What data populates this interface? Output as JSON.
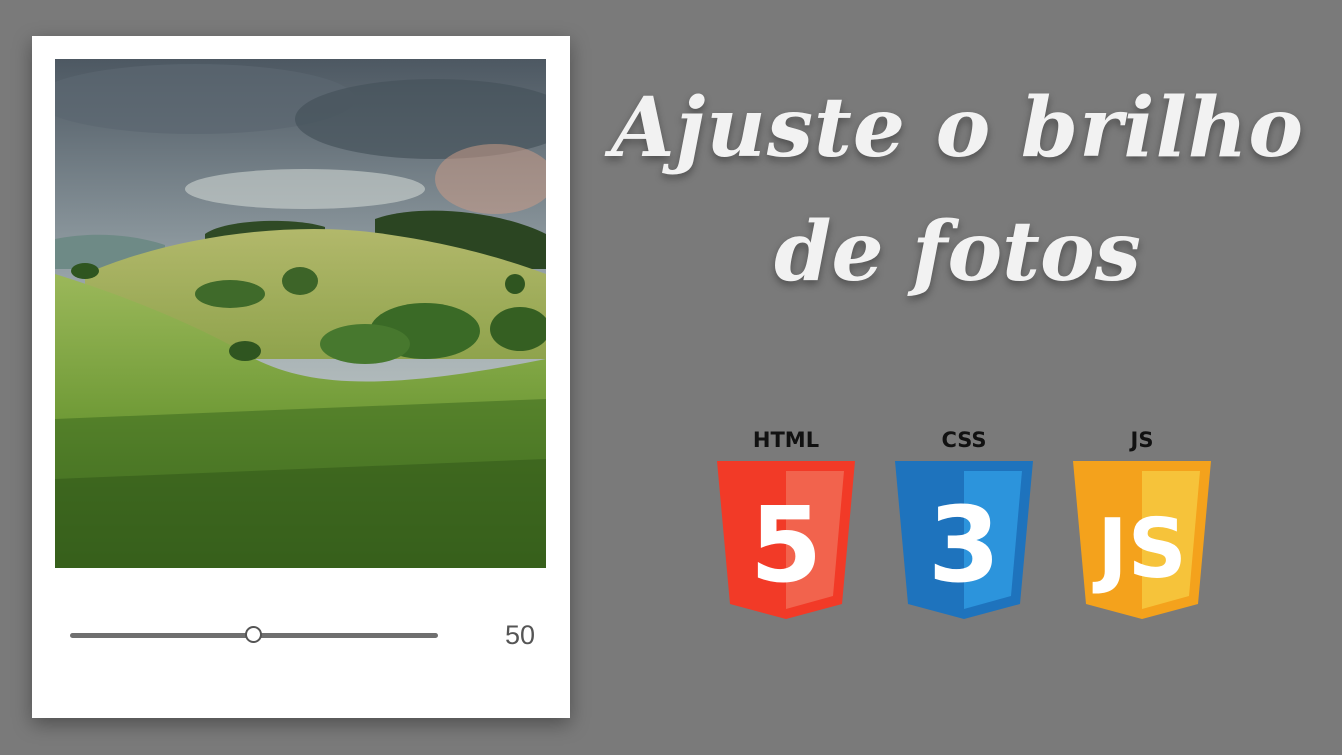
{
  "headline": {
    "line1": "Ajuste o brilho",
    "line2": "de fotos"
  },
  "brightness_control": {
    "value_text": "50",
    "value_fraction": 0.5
  },
  "technologies": [
    {
      "label": "HTML",
      "digit": "5",
      "icon": "html5-shield-icon",
      "color_main": "#f23a27",
      "color_light": "#f2634d"
    },
    {
      "label": "CSS",
      "digit": "3",
      "icon": "css3-shield-icon",
      "color_main": "#1e73bd",
      "color_light": "#2c94dc"
    },
    {
      "label": "JS",
      "digit": "JS",
      "icon": "js-shield-icon",
      "color_main": "#f4a21c",
      "color_light": "#f6c33a"
    }
  ]
}
